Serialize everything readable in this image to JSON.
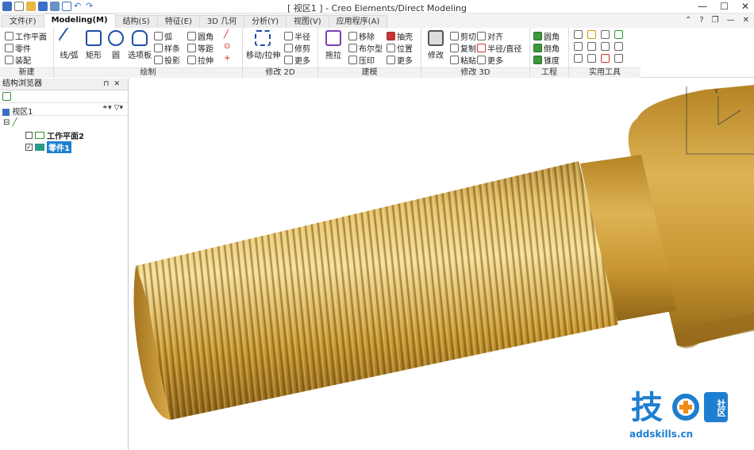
{
  "window": {
    "title": "[ 视区1 ] - Creo Elements/Direct Modeling"
  },
  "tabs": [
    "文件(F)",
    "Modeling(M)",
    "结构(S)",
    "特征(E)",
    "3D 几何",
    "分析(Y)",
    "视图(V)",
    "应用程序(A)"
  ],
  "ribbon": {
    "new": {
      "label": "新建",
      "items": [
        "工作平面",
        "零件",
        "装配"
      ]
    },
    "draw": {
      "label": "绘制",
      "big": [
        "线/弧",
        "矩形",
        "圆",
        "选项板"
      ],
      "small": [
        "弧",
        "样条",
        "投影",
        "圆角",
        "等距",
        "拉伸"
      ]
    },
    "modify2d": {
      "label": "修改 2D",
      "big": "移动/拉伸",
      "small": [
        "半径",
        "修剪",
        "更多"
      ]
    },
    "model": {
      "label": "建模",
      "big": "拖拉",
      "small": [
        "移除",
        "布尔型",
        "压印",
        "抽壳",
        "位置",
        "更多"
      ]
    },
    "modify3d": {
      "label": "修改 3D",
      "big": "修改",
      "small": [
        "剪切",
        "复制",
        "粘贴",
        "对齐",
        "半径/直径",
        "更多"
      ]
    },
    "engineering": {
      "label": "工程",
      "small": [
        "圆角",
        "倒角",
        "锥度"
      ]
    },
    "tools": {
      "label": "实用工具"
    }
  },
  "browser": {
    "title": "结构浏览器",
    "viewport_label": "视区1",
    "items": [
      {
        "label": "工作平面2",
        "checked": false
      },
      {
        "label": "零件1",
        "checked": true,
        "selected": true
      }
    ]
  },
  "watermark": {
    "text": "技",
    "badge": "社区",
    "url": "addskills.cn"
  },
  "colors": {
    "accent": "#1e7fd0",
    "part": "#c89a3a"
  }
}
